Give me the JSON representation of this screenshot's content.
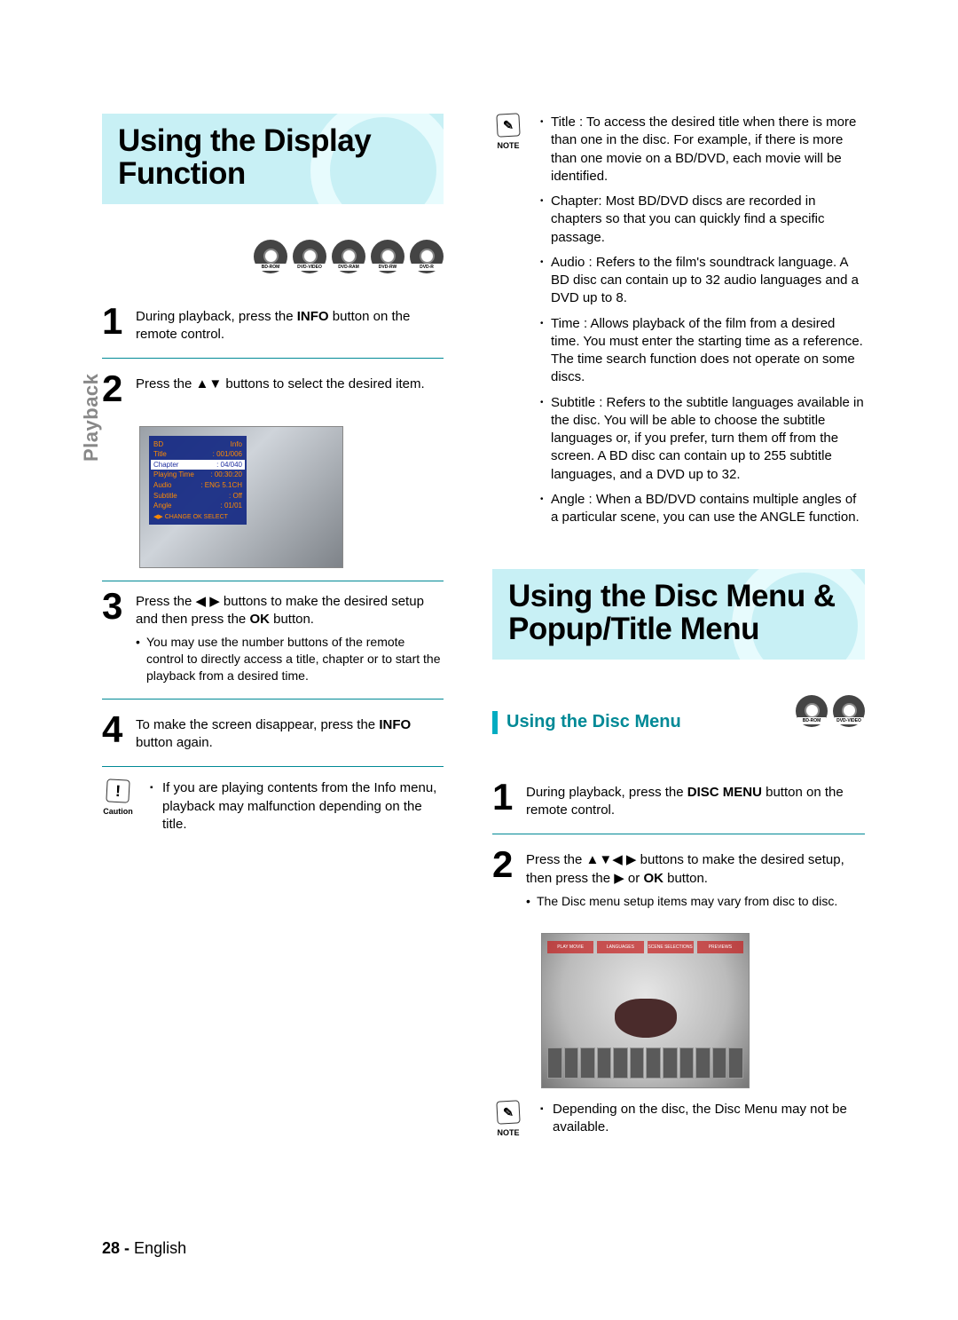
{
  "side_label": "Playback",
  "page_number": "28 -",
  "page_language": "English",
  "left": {
    "banner_title": "Using the Display Function",
    "disc_icons": [
      "BD-ROM",
      "DVD-VIDEO",
      "DVD-RAM",
      "DVD-RW",
      "DVD-R"
    ],
    "steps": {
      "1": {
        "num": "1",
        "pre": "During playback, press the ",
        "bold": "INFO",
        "post": " button on the remote control."
      },
      "2": {
        "num": "2",
        "text": "Press the ▲▼ buttons to select the desired item."
      },
      "3": {
        "num": "3",
        "pre": "Press the ◀ ▶ buttons to make the desired setup and then press the ",
        "bold": "OK",
        "post": " button.",
        "sub": "You may use the number buttons of the remote control to directly access a title, chapter or to start the playback from a desired time."
      },
      "4": {
        "num": "4",
        "pre": "To make the screen disappear, press the ",
        "bold": "INFO",
        "post": " button again."
      }
    },
    "osd": {
      "header_left": "BD",
      "header_right": "Info",
      "rows": [
        {
          "l": "Title",
          "r": ": 001/006"
        },
        {
          "l": "Chapter",
          "r": ": 04/040",
          "hl": true
        },
        {
          "l": "Playing Time",
          "r": ": 00:30:20"
        },
        {
          "l": "Audio",
          "r": ": ENG 5.1CH"
        },
        {
          "l": "Subtitle",
          "r": ": Off"
        },
        {
          "l": "Angle",
          "r": ": 01/01"
        }
      ],
      "foot": "◀▶ CHANGE   OK SELECT"
    },
    "caution": {
      "badge": "!",
      "label": "Caution",
      "text": "If you are playing contents from the Info menu, playback may malfunction depending on the title."
    }
  },
  "right": {
    "top_note": {
      "badge": "✎",
      "label": "NOTE",
      "items": [
        "Title : To access the desired title when there is more than one in the disc. For example, if there is more than one movie on a BD/DVD, each movie will be identified.",
        "Chapter: Most BD/DVD discs are recorded in chapters so that you can quickly find a specific passage.",
        "Audio : Refers to the film's soundtrack language. A BD disc can contain up to 32 audio languages and a DVD up to 8.",
        "Time : Allows playback of the film from a desired time. You must enter the starting time as a reference. The time search function does not operate on some discs.",
        "Subtitle : Refers to the subtitle languages available in the disc. You will be able to choose the subtitle languages or, if you prefer, turn them off from the screen. A BD disc can contain up to 255 subtitle languages, and a DVD up to 32.",
        "Angle : When a BD/DVD contains multiple angles of a particular scene, you can use the ANGLE function."
      ]
    },
    "banner_title": "Using the Disc Menu & Popup/Title Menu",
    "subhead": "Using the Disc Menu",
    "subhead_discs": [
      "BD-ROM",
      "DVD-VIDEO"
    ],
    "steps": {
      "1": {
        "num": "1",
        "pre": "During playback, press the ",
        "bold": "DISC MENU",
        "post": " button on the remote control."
      },
      "2": {
        "num": "2",
        "pre": "Press the ▲▼◀ ▶ buttons to make the desired setup, then press the ▶ or ",
        "bold": "OK",
        "post": " button.",
        "sub": "The Disc menu setup items may vary from disc to disc."
      }
    },
    "menubar": [
      "PLAY MOVIE",
      "LANGUAGES",
      "SCENE SELECTIONS",
      "PREVIEWS"
    ],
    "bottom_note": {
      "badge": "✎",
      "label": "NOTE",
      "text": "Depending on the disc, the Disc Menu may not be available."
    }
  }
}
